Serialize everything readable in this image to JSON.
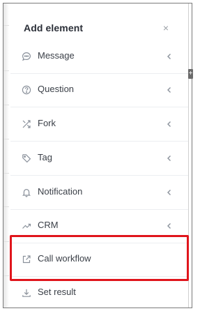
{
  "panel": {
    "title": "Add element",
    "close_glyph": "×",
    "items": [
      {
        "label": "Message",
        "icon": "message-icon",
        "expandable": true
      },
      {
        "label": "Question",
        "icon": "question-icon",
        "expandable": true
      },
      {
        "label": "Fork",
        "icon": "fork-icon",
        "expandable": true
      },
      {
        "label": "Tag",
        "icon": "tag-icon",
        "expandable": true
      },
      {
        "label": "Notification",
        "icon": "bell-icon",
        "expandable": true
      },
      {
        "label": "CRM",
        "icon": "trend-up-icon",
        "expandable": true
      },
      {
        "label": "Call workflow",
        "icon": "external-link-icon",
        "expandable": false
      },
      {
        "label": "Set result",
        "icon": "download-icon",
        "expandable": false
      }
    ],
    "highlighted_item": "Call workflow"
  },
  "colors": {
    "icon": "#8a919b",
    "highlight": "#e0151c",
    "text": "#3a3f47"
  }
}
